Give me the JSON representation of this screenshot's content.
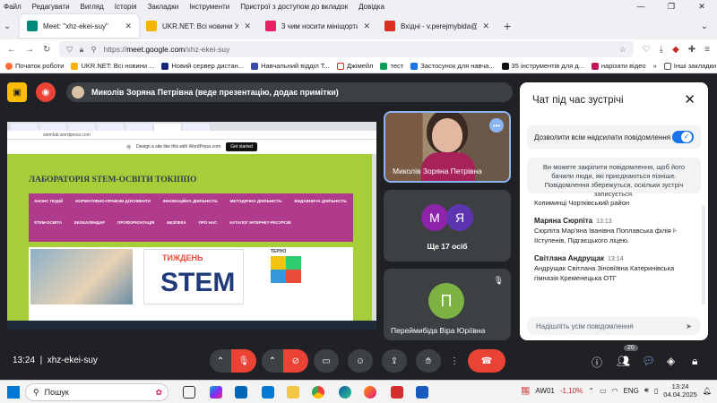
{
  "menu": [
    "Файл",
    "Редагувати",
    "Вигляд",
    "Історія",
    "Закладки",
    "Інструменти",
    "Пристрої з доступом до вкладок",
    "Довідка"
  ],
  "window_controls": [
    "—",
    "❐",
    "✕"
  ],
  "tabs": [
    {
      "title": "Meet: \"xhz-ekei-suy\"",
      "color": "#00897b"
    },
    {
      "title": "UKR.NET: Всі новини Україні",
      "color": "#f4b400"
    },
    {
      "title": "3 чим носити мініщорти - обр",
      "color": "#e91e63"
    },
    {
      "title": "Вхідні - v.perejmybida@ippo.e",
      "color": "#d93025"
    }
  ],
  "url": {
    "prefix": "https://",
    "host": "meet.google.com",
    "path": "/xhz-ekei-suy"
  },
  "bookmarks": [
    {
      "label": "Початок роботи",
      "color": "#ff7139"
    },
    {
      "label": "UKR.NET: Всі новини ...",
      "color": "#f4b400"
    },
    {
      "label": "Новий сервер дистан...",
      "color": "#1a237e"
    },
    {
      "label": "Навчальний відділ Т...",
      "color": "#3949ab"
    },
    {
      "label": "Джімейл",
      "color": "#ffffff"
    },
    {
      "label": "тест",
      "color": "#0f9d58"
    },
    {
      "label": "Застосунок для навча...",
      "color": "#1a73e8"
    },
    {
      "label": "35 інструментів для д...",
      "color": "#111111"
    },
    {
      "label": "нарізати відео",
      "color": "#c2185b"
    }
  ],
  "bookmarks_other": "Інші закладки",
  "presenter": "Миколів Зоряна Петрівна (веде презентацію, додає примітки)",
  "shared": {
    "address": "stemlab.wordpress.com",
    "wp_text": "Design a site like this with WordPress.com",
    "wp_btn": "Get started",
    "title": "ЛАБОРАТОРІЯ STEM-ОСВІТИ ТОКІППО",
    "menu": [
      "АНОНС ПОДІЙ",
      "НОРМАТИВНО-ПРАВОВІ ДОКУМЕНТИ",
      "ІННОВАЦІЙНА ДІЯЛЬНІСТЬ",
      "МЕТОДИЧНА ДІЯЛЬНІСТЬ",
      "ВИДАВНИЧА ДІЯЛЬНІСТЬ",
      "STEM-ОСВІТА",
      "ЕКОКАЛЕНДАР",
      "ПРОФОРІЄНТАЦІЯ",
      "БЕЗПЕКА",
      "ПРО НАС",
      "КАТАЛОГ ІНТЕРНЕТ-РЕСУРСІВ"
    ],
    "stem_week": "ТИЖДЕНЬ",
    "stem": "STEM",
    "side": "ТЕРНО"
  },
  "tiles": {
    "main_name": "Миколів Зоряна Петрівна",
    "more_label": "Ще 17 осіб",
    "avatars": [
      {
        "letter": "М",
        "color": "#8e24aa"
      },
      {
        "letter": "Я",
        "color": "#5e35b1"
      }
    ],
    "p_letter": "П",
    "p_name": "Переймибіда Віра Юріївна"
  },
  "chat": {
    "title": "Чат під час зустрічі",
    "toggle_label": "Дозволити всім надсилати повідомлення",
    "info": "Ви можете закріпити повідомлення, щоб його бачили люди, які приєднаються пізніше. Повідомлення збережуться, оскільки зустріч записується.",
    "partial": "Копиминці Чортківський район",
    "messages": [
      {
        "who": "Маряна Сюрпіта",
        "time": "13:13",
        "text": "Сюрпіта Мар'яна Іванівна Поплавська філія І-ІІступенів, Підгаєцького ліцею."
      },
      {
        "who": "Світлана Андрущак",
        "time": "13:14",
        "text": "Андрущак Світлана Зіновіївна Катеринівська гімназія Кременецька ОТГ"
      }
    ],
    "input_placeholder": "Надішліть усім повідомлення"
  },
  "bottom": {
    "time": "13:24",
    "code": "xhz-ekei-suy",
    "badge": "20"
  },
  "taskbar": {
    "search": "Пошук",
    "stock": "AW01",
    "stock_change": "-1,10%",
    "lang": "ENG",
    "time": "13:24",
    "date": "04.04.2025"
  }
}
